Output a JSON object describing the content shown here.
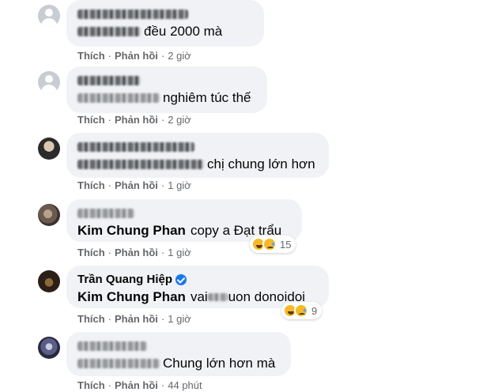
{
  "actions": {
    "like": "Thích",
    "reply": "Phản hồi",
    "separator": "·"
  },
  "comments": [
    {
      "name": "",
      "text": "đều 2000 mà",
      "time": "2 giờ",
      "avatar": "default-avatar"
    },
    {
      "name": "",
      "text": "nghiêm túc thế",
      "time": "2 giờ",
      "avatar": "default-avatar"
    },
    {
      "name": "",
      "text": "chị chung lớn hơn",
      "time": "1 giờ",
      "avatar": "profile-photo"
    },
    {
      "name": "",
      "tag": "Kim Chung Phan",
      "text": "copy a Đạt trẩu",
      "time": "1 giờ",
      "avatar": "profile-photo",
      "reaction_count": "15"
    },
    {
      "name": "Trần Quang Hiệp",
      "tag": "Kim Chung Phan",
      "text_before": "vai",
      "text": "uon donoidoi",
      "time": "1 giờ",
      "avatar": "profile-photo",
      "verified": true,
      "reaction_count": "9"
    },
    {
      "name": "",
      "text": "Chung lớn hơn mà",
      "time": "44 phút",
      "avatar": "profile-photo"
    }
  ],
  "reaction_icons": [
    "haha-emoji-icon",
    "sad-emoji-icon"
  ],
  "colors": {
    "bubble": "#f0f2f5",
    "meta": "#65676b",
    "text": "#050505",
    "verified": "#1877f2"
  }
}
